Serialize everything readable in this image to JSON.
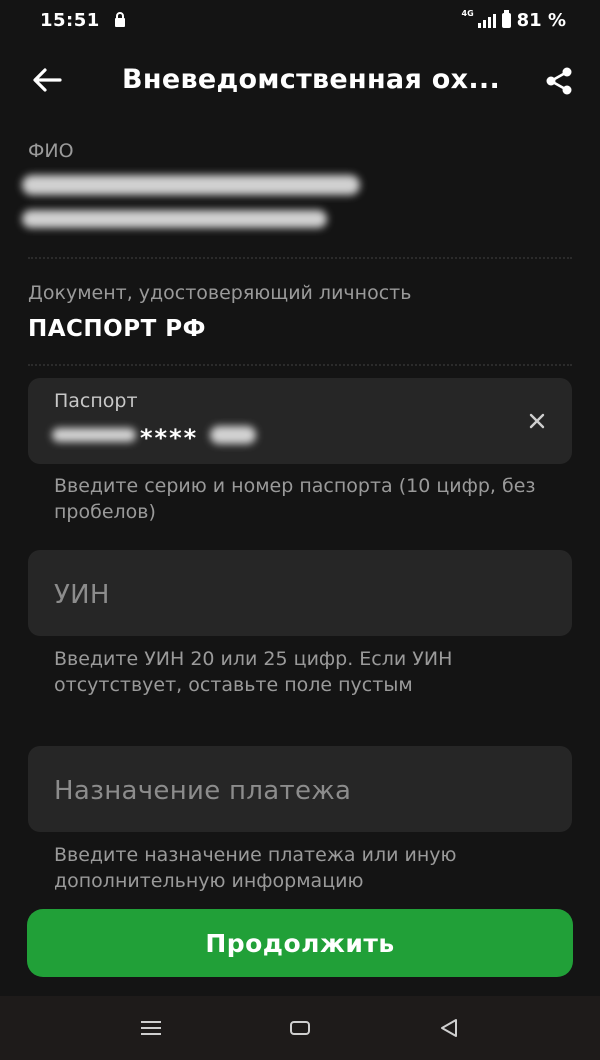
{
  "status_bar": {
    "time": "15:51",
    "network": "4G",
    "battery": "81 %"
  },
  "header": {
    "title": "Вневедомственная ох..."
  },
  "fio": {
    "label": "ФИО"
  },
  "document": {
    "label": "Документ, удостоверяющий личность",
    "value": "ПАСПОРТ РФ"
  },
  "passport_field": {
    "label": "Паспорт",
    "value": "****",
    "hint": "Введите серию и номер паспорта (10 цифр, без пробелов)"
  },
  "uin_field": {
    "placeholder": "УИН",
    "hint": "Введите УИН 20 или 25 цифр. Если УИН отсутствует, оставьте поле пустым"
  },
  "purpose_field": {
    "placeholder": "Назначение платежа",
    "hint": "Введите назначение платежа или иную дополнительную информацию"
  },
  "continue_button": {
    "label": "Продолжить"
  },
  "colors": {
    "background": "#141414",
    "input_background": "#262626",
    "accent_green": "#21a038"
  },
  "icons": [
    "back-arrow-icon",
    "share-icon",
    "close-icon",
    "menu-icon",
    "home-icon",
    "back-triangle-icon",
    "lock-icon",
    "signal-icon",
    "battery-icon"
  ]
}
